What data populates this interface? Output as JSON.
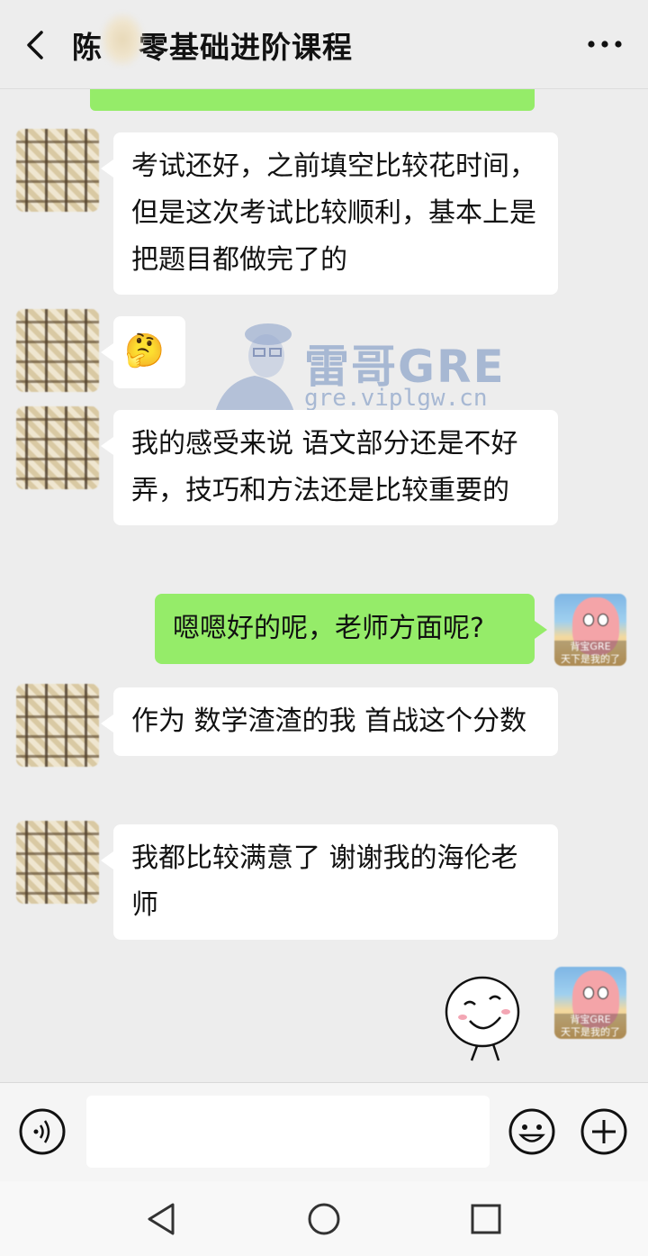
{
  "header": {
    "title_left": "陈",
    "title_right": "零基础进阶课程"
  },
  "messages": [
    {
      "id": "m1",
      "side": "left",
      "text": "考试还好，之前填空比较花时间，但是这次考试比较顺利，基本上是把题目都做完了的"
    },
    {
      "id": "m2",
      "side": "left",
      "type": "emoji",
      "text": "🤔"
    },
    {
      "id": "m3",
      "side": "left",
      "text": "我的感受来说 语文部分还是不好弄，技巧和方法还是比较重要的"
    },
    {
      "id": "m4",
      "side": "right",
      "text": "嗯嗯好的呢，老师方面呢?"
    },
    {
      "id": "m5",
      "side": "left",
      "text": "作为 数学渣渣的我 首战这个分数"
    },
    {
      "id": "m6",
      "side": "left",
      "text": "我都比较满意了 谢谢我的海伦老师"
    },
    {
      "id": "m7",
      "side": "right",
      "type": "sticker"
    }
  ],
  "my_avatar": {
    "caption_line1": "背宝GRE",
    "caption_line2": "天下是我的了"
  },
  "watermark": {
    "title": "雷哥GRE",
    "url": "gre.viplgw.cn"
  },
  "colors": {
    "my_bubble": "#95ec69",
    "their_bubble": "#ffffff",
    "background": "#ededed"
  }
}
